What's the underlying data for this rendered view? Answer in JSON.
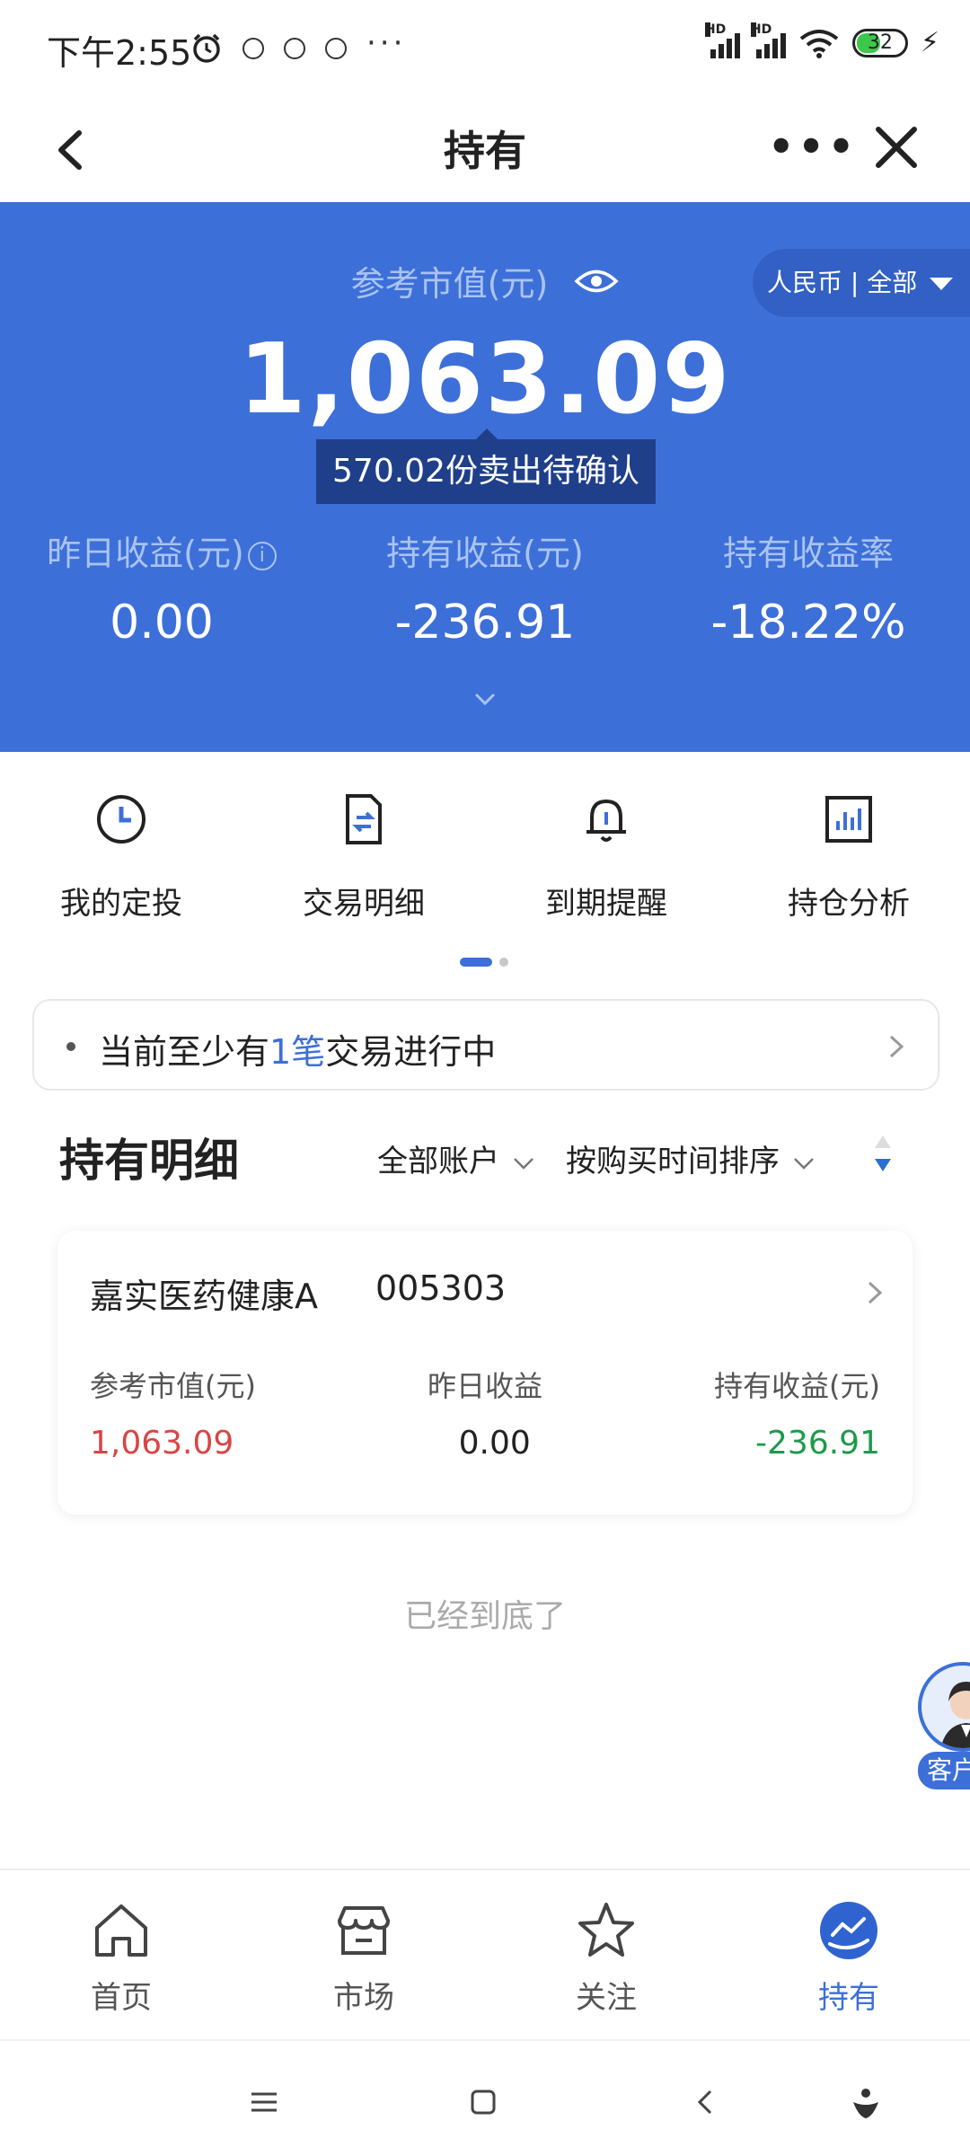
{
  "status_bar": {
    "time": "下午2:55",
    "battery": "32"
  },
  "nav": {
    "title": "持有"
  },
  "summary": {
    "ref_value_label": "参考市值(元)",
    "currency_filter": "人民币 | 全部",
    "total_value": "1,063.09",
    "pending_tip": "570.02份卖出待确认",
    "stats": [
      {
        "label": "昨日收益(元)",
        "value": "0.00"
      },
      {
        "label": "持有收益(元)",
        "value": "-236.91"
      },
      {
        "label": "持有收益率",
        "value": "-18.22%"
      }
    ]
  },
  "quick_actions": [
    {
      "label": "我的定投",
      "icon": "clock-icon"
    },
    {
      "label": "交易明细",
      "icon": "document-transfer-icon"
    },
    {
      "label": "到期提醒",
      "icon": "bell-icon"
    },
    {
      "label": "持仓分析",
      "icon": "bar-chart-icon"
    }
  ],
  "pending_txn": {
    "prefix": "当前至少有",
    "count": "1笔",
    "suffix": "交易进行中"
  },
  "holdings": {
    "title": "持有明细",
    "account_filter": "全部账户",
    "sort_filter": "按购买时间排序",
    "funds": [
      {
        "name": "嘉实医药健康A",
        "code": "005303",
        "col_labels": [
          "参考市值(元)",
          "昨日收益",
          "持有收益(元)"
        ],
        "market_value": "1,063.09",
        "yesterday_gain": "0.00",
        "holding_gain": "-236.91"
      }
    ],
    "end_note": "已经到底了"
  },
  "customer_service": {
    "label": "客户"
  },
  "tabbar": [
    {
      "label": "首页",
      "icon": "home-icon",
      "active": false
    },
    {
      "label": "市场",
      "icon": "store-icon",
      "active": false
    },
    {
      "label": "关注",
      "icon": "star-icon",
      "active": false
    },
    {
      "label": "持有",
      "icon": "holdings-icon",
      "active": true
    }
  ],
  "colors": {
    "hero_blue": "#3d6fd8",
    "tooltip_dark": "#1f3f8a",
    "gain_red": "#d94545",
    "loss_green": "#1d9a4a"
  }
}
